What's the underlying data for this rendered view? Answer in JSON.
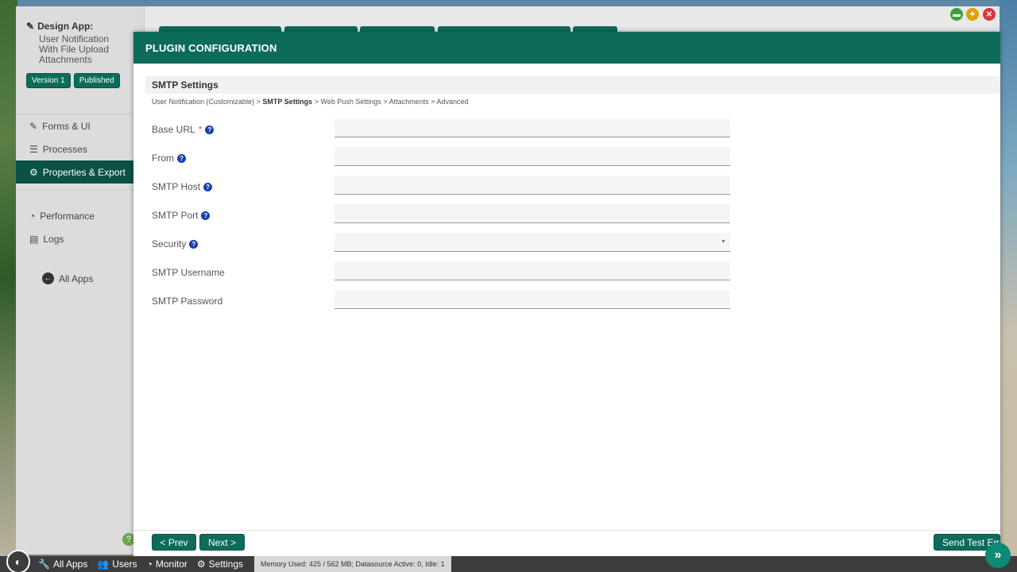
{
  "sidebar": {
    "design_label": "Design App:",
    "app_name": "User Notification With File Upload Attachments",
    "version_badge": "Version 1",
    "status_badge": "Published",
    "nav": [
      {
        "label": "Forms & UI",
        "icon": "edit-icon"
      },
      {
        "label": "Processes",
        "icon": "list-icon"
      },
      {
        "label": "Properties & Export",
        "icon": "gear-icon"
      }
    ],
    "nav2": [
      {
        "label": "Performance",
        "icon": "dashboard-icon"
      },
      {
        "label": "Logs",
        "icon": "logs-icon"
      }
    ],
    "all_apps": "All Apps",
    "help": "?"
  },
  "modal": {
    "title": "PLUGIN CONFIGURATION",
    "section": "SMTP Settings",
    "breadcrumbs": {
      "c1": "User Notification (Customizable)",
      "sep": ">",
      "c2": "SMTP Settings",
      "c3": "Web Push Settings",
      "c4": "Attachments",
      "c5": "Advanced"
    },
    "fields": [
      {
        "label": "Base URL",
        "required": "*",
        "value": ""
      },
      {
        "label": "From",
        "value": ""
      },
      {
        "label": "SMTP Host",
        "value": ""
      },
      {
        "label": "SMTP Port",
        "value": ""
      },
      {
        "label": "Security",
        "value": ""
      },
      {
        "label": "SMTP Username",
        "value": ""
      },
      {
        "label": "SMTP Password",
        "value": ""
      }
    ],
    "buttons": {
      "prev": "< Prev",
      "next": "Next >",
      "send_test": "Send Test Em"
    }
  },
  "taskbar": {
    "all_apps": "All Apps",
    "users": "Users",
    "monitor": "Monitor",
    "settings": "Settings",
    "memory": "Memory Used: 425 / 562 MB; Datasource Active: 0, Idle: 1"
  },
  "colors": {
    "brand": "#0d6b5a",
    "active_nav": "#0a5245",
    "help_icon": "#1a3fb0",
    "required": "#d9534f"
  }
}
